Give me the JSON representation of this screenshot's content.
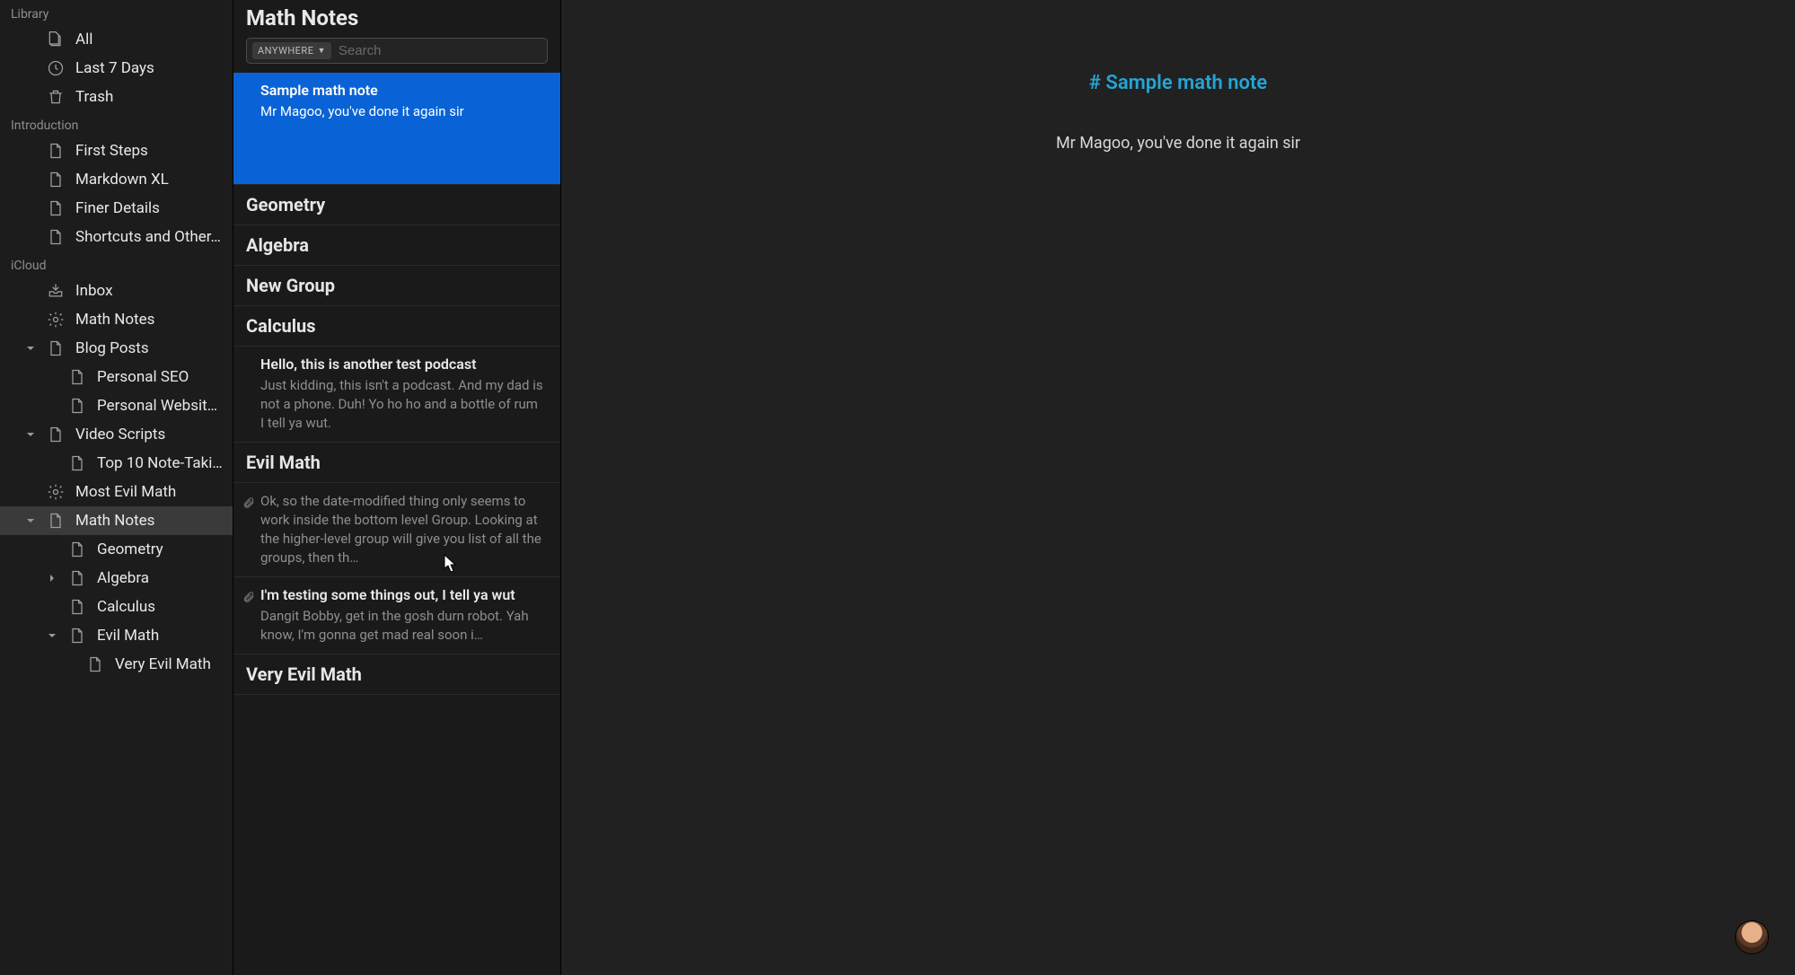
{
  "sidebar": {
    "sections": [
      {
        "label": "Library",
        "items": [
          {
            "icon": "stack",
            "label": "All"
          },
          {
            "icon": "clock",
            "label": "Last 7 Days"
          },
          {
            "icon": "trash",
            "label": "Trash"
          }
        ]
      },
      {
        "label": "Introduction",
        "items": [
          {
            "icon": "doc",
            "label": "First Steps"
          },
          {
            "icon": "doc",
            "label": "Markdown XL"
          },
          {
            "icon": "doc",
            "label": "Finer Details"
          },
          {
            "icon": "doc",
            "label": "Shortcuts and Other…"
          }
        ]
      },
      {
        "label": "iCloud",
        "items": [
          {
            "icon": "inbox",
            "label": "Inbox"
          },
          {
            "icon": "gear",
            "label": "Math Notes"
          },
          {
            "icon": "doc",
            "label": "Blog Posts",
            "disclosure": "down"
          },
          {
            "icon": "doc",
            "label": "Personal SEO",
            "indent": 2
          },
          {
            "icon": "doc",
            "label": "Personal Website…",
            "indent": 2
          },
          {
            "icon": "doc",
            "label": "Video Scripts",
            "disclosure": "down"
          },
          {
            "icon": "doc",
            "label": "Top 10 Note-Takin…",
            "indent": 2
          },
          {
            "icon": "gear",
            "label": "Most Evil Math"
          },
          {
            "icon": "doc",
            "label": "Math Notes",
            "disclosure": "down",
            "selected": true
          },
          {
            "icon": "doc",
            "label": "Geometry",
            "indent": 2
          },
          {
            "icon": "doc",
            "label": "Algebra",
            "indent": 2,
            "disclosure": "right"
          },
          {
            "icon": "doc",
            "label": "Calculus",
            "indent": 2
          },
          {
            "icon": "doc",
            "label": "Evil Math",
            "indent": 2,
            "disclosure": "down"
          },
          {
            "icon": "doc",
            "label": "Very Evil Math",
            "indent": 3
          }
        ]
      }
    ]
  },
  "notelist": {
    "title": "Math Notes",
    "scope_label": "ANYWHERE",
    "search_placeholder": "Search",
    "items": [
      {
        "type": "note",
        "title": "Sample math note",
        "preview": "Mr Magoo, you've done it again sir",
        "selected": true,
        "tall": true
      },
      {
        "type": "group",
        "label": "Geometry"
      },
      {
        "type": "group",
        "label": "Algebra"
      },
      {
        "type": "group",
        "label": "New Group"
      },
      {
        "type": "group",
        "label": "Calculus"
      },
      {
        "type": "note",
        "title": "Hello, this is another test podcast",
        "preview": "Just kidding, this isn't a podcast. And my dad is not a phone. Duh! Yo ho ho and a bottle of rum I tell ya wut."
      },
      {
        "type": "group",
        "label": "Evil Math"
      },
      {
        "type": "note",
        "title_dim": true,
        "attachment": true,
        "title": "",
        "preview": "Ok, so the date-modified thing only seems to work inside the bottom level Group. Looking at the higher-level group will give you list of all the groups, then th…"
      },
      {
        "type": "note",
        "attachment": true,
        "title": "I'm testing some things out, I tell ya wut",
        "preview": "Dangit Bobby, get in the gosh durn robot. Yah know, I'm gonna get mad real soon i…"
      },
      {
        "type": "group",
        "label": "Very Evil Math"
      }
    ]
  },
  "editor": {
    "heading": "# Sample math note",
    "body": "Mr Magoo, you've done it again sir"
  }
}
